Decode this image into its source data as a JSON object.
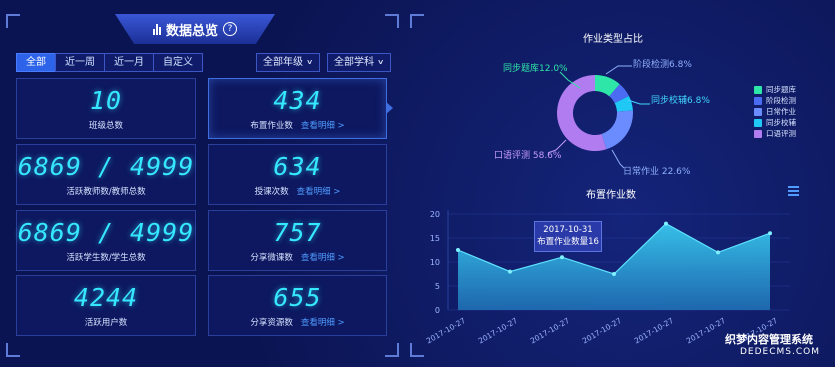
{
  "left": {
    "title": "数据总览",
    "filters": [
      "全部",
      "近一周",
      "近一月",
      "自定义"
    ],
    "active_filter": 0,
    "grade_select": "全部年级",
    "subject_select": "全部学科",
    "cards": [
      {
        "value": "10",
        "label": "班级总数",
        "link": ""
      },
      {
        "value": "434",
        "label": "布置作业数",
        "link": "查看明细 >"
      },
      {
        "value": "6869 / 4999",
        "label": "活跃教师数/教师总数",
        "link": ""
      },
      {
        "value": "634",
        "label": "授课次数",
        "link": "查看明细 >"
      },
      {
        "value": "6869 / 4999",
        "label": "活跃学生数/学生总数",
        "link": ""
      },
      {
        "value": "757",
        "label": "分享微课数",
        "link": "查看明细 >"
      },
      {
        "value": "4244",
        "label": "活跃用户数",
        "link": ""
      },
      {
        "value": "655",
        "label": "分享资源数",
        "link": "查看明细 >"
      }
    ]
  },
  "right": {
    "pie_title": "作业类型占比",
    "pie_labels": {
      "tiku": "同步题库12.0%",
      "jieduan": "阶段检测6.8%",
      "jiaofu": "同步校辅6.8%",
      "richang": "日常作业 22.6%",
      "kouyu": "口语评测 58.6%"
    },
    "legend": [
      "同步题库",
      "阶段检测",
      "日常作业",
      "同步校辅",
      "口语评测"
    ],
    "legend_colors": [
      "#2ee6a8",
      "#4b6cf2",
      "#6a8cff",
      "#1fc8f5",
      "#b07cf0"
    ],
    "area_title": "布置作业数",
    "tooltip_date": "2017-10-31",
    "tooltip_text": "布置作业数量16",
    "watermark_top": "织梦内容管理系统",
    "watermark_bottom": "DEDECMS.COM"
  },
  "chart_data": [
    {
      "type": "pie",
      "title": "作业类型占比",
      "labels": [
        "同步题库",
        "阶段检测",
        "同步校辅",
        "日常作业",
        "口语评测"
      ],
      "values": [
        12.0,
        6.8,
        6.8,
        22.6,
        58.6
      ],
      "colors": [
        "#2ee6a8",
        "#4b6cf2",
        "#1fc8f5",
        "#6a8cff",
        "#b07cf0"
      ]
    },
    {
      "type": "area",
      "title": "布置作业数",
      "x": [
        "2017-10-27",
        "2017-10-27",
        "2017-10-27",
        "2017-10-27",
        "2017-10-27",
        "2017-10-27",
        "2017-10-27"
      ],
      "values": [
        12.5,
        8,
        11,
        7.5,
        18,
        12,
        16
      ],
      "ylim": [
        0,
        20
      ],
      "yticks": [
        0,
        5,
        10,
        15,
        20
      ],
      "color": "#2fb7e0"
    }
  ]
}
